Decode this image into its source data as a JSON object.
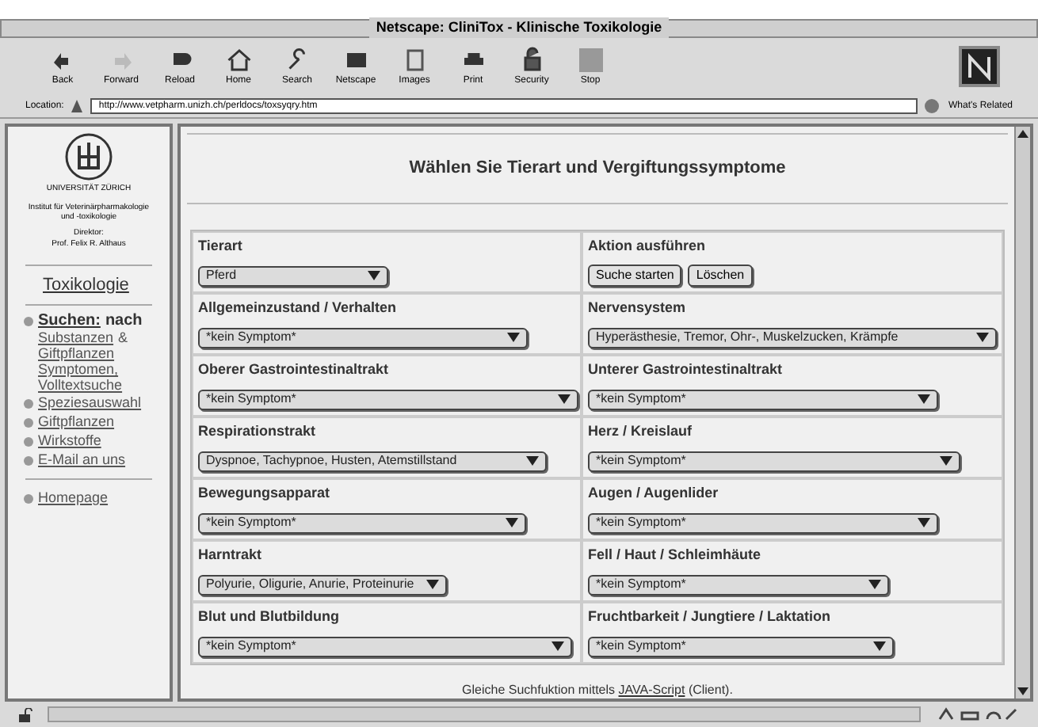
{
  "window": {
    "title": "Netscape: CliniTox - Klinische Toxikologie"
  },
  "toolbar": [
    "Back",
    "Forward",
    "Reload",
    "Home",
    "Search",
    "Netscape",
    "Images",
    "Print",
    "Security",
    "Stop"
  ],
  "location": {
    "label": "Location:",
    "url": "http://www.vetpharm.unizh.ch/perldocs/toxsyqry.htm",
    "related": "What's Related"
  },
  "sidebar": {
    "university": "UNIVERSITÄT ZÜRICH",
    "institute": "Institut für Veterinärpharmakologie und -toxikologie",
    "director_label": "Direktor:",
    "director": "Prof. Felix R. Althaus",
    "heading": "Toxikologie",
    "nav": [
      {
        "label": "Suchen:",
        "suffix": "nach",
        "children": [
          {
            "label": "Substanzen",
            "after": "&"
          },
          {
            "label": "Giftpflanzen"
          },
          {
            "label": "Symptomen,"
          },
          {
            "label": "Volltextsuche"
          }
        ]
      },
      {
        "label": "Speziesauswahl"
      },
      {
        "label": "Giftpflanzen"
      },
      {
        "label": "Wirkstoffe"
      },
      {
        "label": "E-Mail an uns"
      }
    ],
    "home": "Homepage"
  },
  "page": {
    "title": "Wählen Sie Tierart und Vergiftungssymptome",
    "cells": [
      {
        "kind": "select",
        "label": "Tierart",
        "value": "Pferd"
      },
      {
        "kind": "actions",
        "label": "Aktion ausführen",
        "buttons": [
          "Suche starten",
          "Löschen"
        ]
      },
      {
        "kind": "select",
        "label": "Allgemeinzustand / Verhalten",
        "value": "*kein Symptom*"
      },
      {
        "kind": "select",
        "label": "Nervensystem",
        "value": "Hyperästhesie, Tremor, Ohr-, Muskelzucken, Krämpfe"
      },
      {
        "kind": "select",
        "label": "Oberer Gastrointestinaltrakt",
        "value": "*kein Symptom*"
      },
      {
        "kind": "select",
        "label": "Unterer Gastrointestinaltrakt",
        "value": "*kein Symptom*"
      },
      {
        "kind": "select",
        "label": "Respirationstrakt",
        "value": "Dyspnoe, Tachypnoe, Husten, Atemstillstand"
      },
      {
        "kind": "select",
        "label": "Herz / Kreislauf",
        "value": "*kein Symptom*"
      },
      {
        "kind": "select",
        "label": "Bewegungsapparat",
        "value": "*kein Symptom*"
      },
      {
        "kind": "select",
        "label": "Augen / Augenlider",
        "value": "*kein Symptom*"
      },
      {
        "kind": "select",
        "label": "Harntrakt",
        "value": "Polyurie, Oligurie, Anurie, Proteinurie"
      },
      {
        "kind": "select",
        "label": "Fell / Haut / Schleimhäute",
        "value": "*kein Symptom*"
      },
      {
        "kind": "select",
        "label": "Blut und Blutbildung",
        "value": "*kein Symptom*"
      },
      {
        "kind": "select",
        "label": "Fruchtbarkeit / Jungtiere / Laktation",
        "value": "*kein Symptom*"
      }
    ],
    "footer": {
      "before": "Gleiche Suchfuktion mittels",
      "link": "JAVA-Script",
      "after": "(Client)."
    }
  }
}
